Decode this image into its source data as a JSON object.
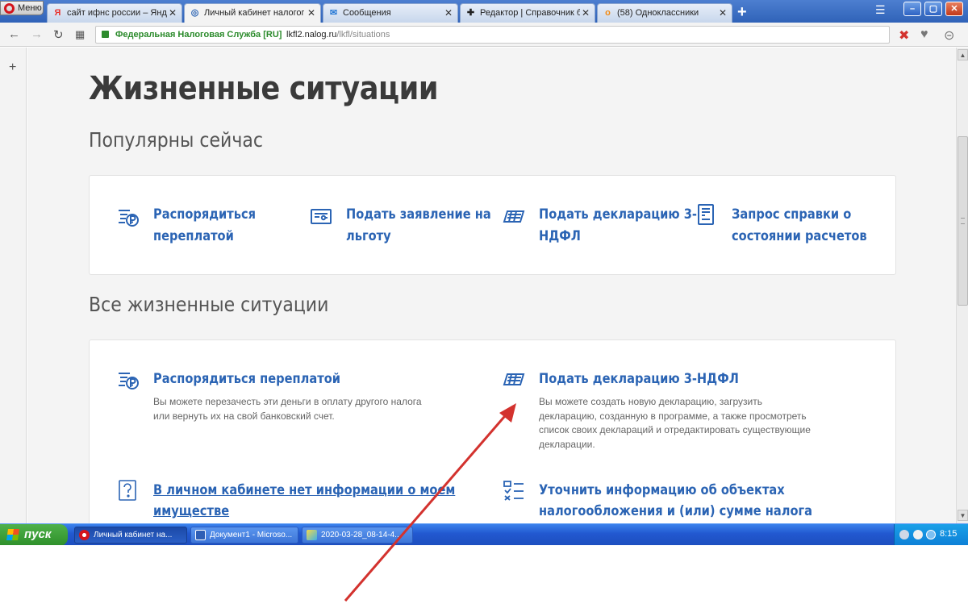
{
  "browser": {
    "menu_label": "Меню",
    "tabs": [
      {
        "favicon": "Я",
        "label": "сайт ифнс россии – Яндекс",
        "active": false
      },
      {
        "favicon": "◎",
        "label": "Личный кабинет налогоплательщика",
        "active": true
      },
      {
        "favicon": "✉",
        "label": "Сообщения",
        "active": false
      },
      {
        "favicon": "✚",
        "label": "Редактор | Справочник бухгалтера",
        "active": false
      },
      {
        "favicon": "o",
        "label": "(58) Одноклассники",
        "active": false
      }
    ],
    "new_tab": "+",
    "site_identity": "Федеральная Налоговая Служба [RU]",
    "url_host": "lkfl2.nalog.ru",
    "url_path": "/lkfl/situations"
  },
  "page": {
    "title": "Жизненные ситуации",
    "popular_heading": "Популярны сейчас",
    "popular": [
      {
        "line1": "Распорядиться",
        "line2": "переплатой",
        "icon": "ruble-doc-icon"
      },
      {
        "line1": "Подать заявление на",
        "line2": "льготу",
        "icon": "application-icon"
      },
      {
        "line1": "Подать декларацию 3-",
        "line2": "НДФЛ",
        "icon": "declaration-icon"
      },
      {
        "line1": "Запрос справки о",
        "line2": "состоянии расчетов",
        "icon": "certificate-icon"
      }
    ],
    "all_heading": "Все жизненные ситуации",
    "all": [
      {
        "title": "Распорядиться переплатой",
        "desc": "Вы можете перезачесть эти деньги в оплату другого налога или вернуть их на свой банковский счет.",
        "icon": "ruble-doc-icon"
      },
      {
        "title": "Подать декларацию 3-НДФЛ",
        "desc": "Вы можете создать новую декларацию, загрузить декларацию, созданную в программе, а также просмотреть список своих деклараций и отредактировать существующие декларации.",
        "icon": "declaration-icon"
      },
      {
        "title_line1": "В личном кабинете нет информации о моем",
        "title_line2": "имуществе",
        "icon": "question-icon"
      },
      {
        "title_line1": "Уточнить информацию об объектах",
        "title_line2": "налогообложения и (или) сумме налога",
        "icon": "checklist-icon"
      }
    ]
  },
  "taskbar": {
    "start_label": "пуск",
    "items": [
      {
        "label": "Личный кабинет на...",
        "active": true
      },
      {
        "label": "Документ1 - Microso...",
        "active": false
      },
      {
        "label": "2020-03-28_08-14-4...",
        "active": false
      }
    ],
    "clock": "8:15"
  },
  "colors": {
    "link_blue": "#2b64b4",
    "annotation_arrow": "#d3322e",
    "taskbar_blue": "#2258d0",
    "start_green": "#3a9a35"
  }
}
